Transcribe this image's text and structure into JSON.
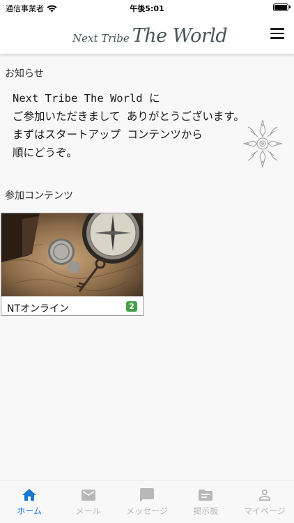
{
  "status_bar": {
    "carrier": "通信事業者",
    "time": "午後5:01"
  },
  "header": {
    "logo_small": "Next Tribe",
    "logo_big": "The World",
    "menu_icon": "hamburger-menu-icon"
  },
  "notice": {
    "heading": "お知らせ",
    "body": "Next Tribe The World に\nご参加いただきまして ありがとうございます。\nまずはスタートアップ コンテンツから\n順にどうぞ。"
  },
  "contents": {
    "heading": "参加コンテンツ",
    "cards": [
      {
        "title": "NTオンライン",
        "badge": "2",
        "image": "vintage-map-coin-compass-key-photo"
      }
    ]
  },
  "bottom_nav": {
    "items": [
      {
        "label": "ホーム",
        "icon": "home-icon",
        "active": true
      },
      {
        "label": "メール",
        "icon": "mail-icon",
        "active": false
      },
      {
        "label": "メッセージ",
        "icon": "message-icon",
        "active": false
      },
      {
        "label": "掲示板",
        "icon": "folder-icon",
        "active": false
      },
      {
        "label": "マイページ",
        "icon": "person-icon",
        "active": false
      }
    ]
  },
  "colors": {
    "accent": "#1976d2",
    "badge": "#43a047",
    "inactive": "#b8b8b8"
  }
}
